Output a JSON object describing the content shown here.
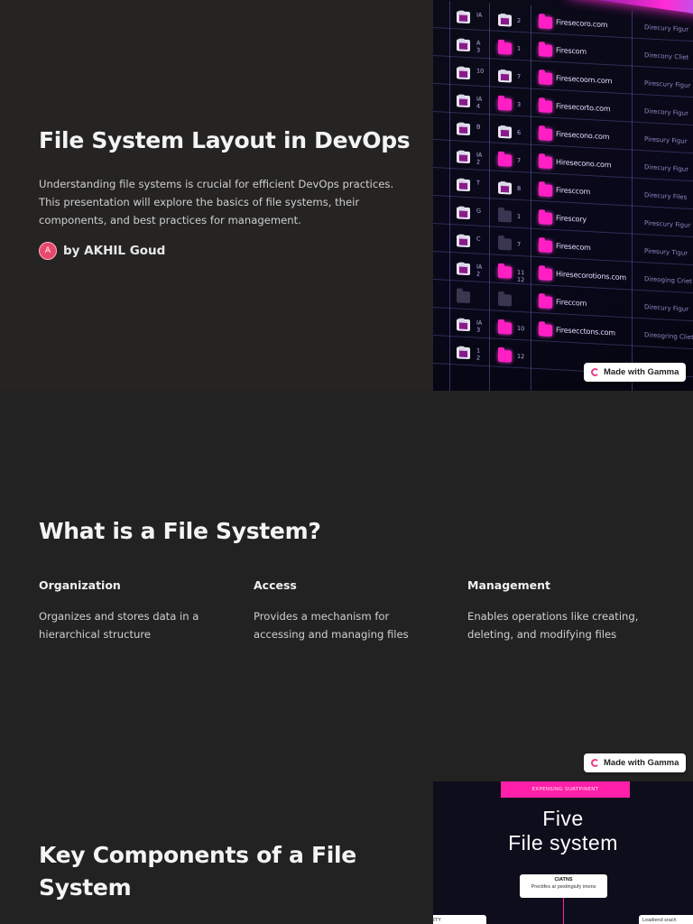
{
  "slide1": {
    "title": "File System Layout in DevOps",
    "description": "Understanding file systems is crucial for efficient DevOps practices. This presentation will explore the basics of file systems, their components, and best practices for management.",
    "avatar_letter": "A",
    "author": "by AKHIL Goud",
    "image": {
      "row_codes": [
        "IA",
        "A\n3",
        "10",
        "IA\n4",
        "B",
        "IA\n2",
        "T",
        "G",
        "C",
        "IA\n2",
        "",
        "IA\n3",
        "1\n2"
      ],
      "num_codes": [
        "2",
        "1",
        "7",
        "3",
        "6",
        "7",
        "8",
        "1",
        "7",
        "11\n12",
        "",
        "10",
        "12"
      ],
      "domains": [
        "Firesecoro.com",
        "Firescom",
        "Firesecoom.com",
        "Firesecorto.com",
        "Firesecono.com",
        "Hiresecono.com",
        "Firesccom",
        "Firescory",
        "Firesecom",
        "Hiresecorotions.com",
        "Fireccom",
        "Firesecctons.com",
        ""
      ],
      "dirs": [
        "Direcury Figur",
        "Direcony Cliet",
        "Pirescury Figur",
        "Direcory Figur",
        "Piresury Figur",
        "Direcury Figur",
        "Direcury Files",
        "Pirescury Figur",
        "Piresury Tigur",
        "Direoging Criet",
        "Direcury Figur",
        "Direogring Cliet",
        ""
      ]
    },
    "badge": "Made with Gamma"
  },
  "slide2": {
    "title": "What is a File System?",
    "columns": [
      {
        "heading": "Organization",
        "text": "Organizes and stores data in a hierarchical structure"
      },
      {
        "heading": "Access",
        "text": "Provides a mechanism for accessing and managing files"
      },
      {
        "heading": "Management",
        "text": "Enables operations like creating, deleting, and modifying files"
      }
    ],
    "badge": "Made with Gamma"
  },
  "slide3": {
    "title": "Key Components of a File System",
    "image": {
      "banner": "EXPENSING SURTPINENT",
      "line1": "Five",
      "line2": "File  system",
      "card_title": "CIATNS",
      "card_text": "Prectifes ar pestingiufy imons",
      "left_card": "RTY",
      "right_card": "Leadiend srach"
    }
  },
  "colors": {
    "background": "#232222",
    "accent_magenta": "#ff1fc4",
    "avatar": "#e8496d",
    "text_primary": "#f4f4f4",
    "text_secondary": "#cfcfcf"
  }
}
